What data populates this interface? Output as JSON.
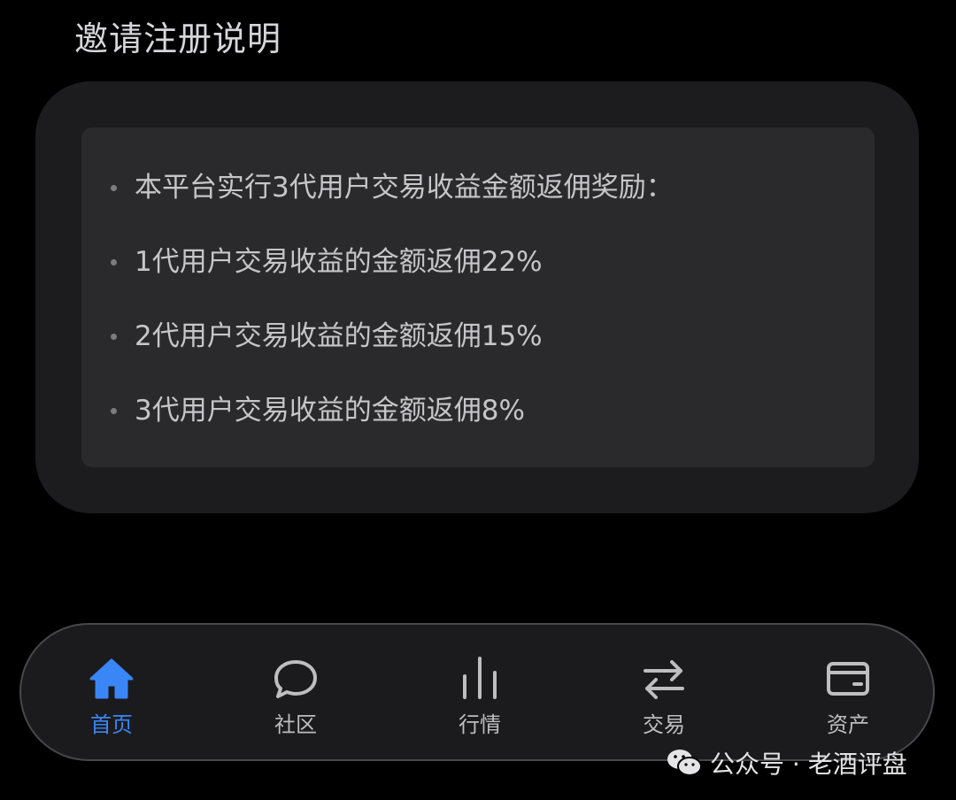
{
  "page": {
    "title": "邀请注册说明"
  },
  "rules": [
    "本平台实行3代用户交易收益金额返佣奖励：",
    "1代用户交易收益的金额返佣22%",
    "2代用户交易收益的金额返佣15%",
    "3代用户交易收益的金额返佣8%"
  ],
  "tabbar": {
    "items": [
      {
        "label": "首页",
        "icon": "home-icon",
        "active": true
      },
      {
        "label": "社区",
        "icon": "chat-bubble-icon",
        "active": false
      },
      {
        "label": "行情",
        "icon": "bar-chart-icon",
        "active": false
      },
      {
        "label": "交易",
        "icon": "swap-arrows-icon",
        "active": false
      },
      {
        "label": "资产",
        "icon": "wallet-card-icon",
        "active": false
      }
    ]
  },
  "watermark": {
    "text": "公众号 · 老酒评盘",
    "icon": "wechat-icon"
  },
  "colors": {
    "background": "#000000",
    "card_outer": "#1c1c1e",
    "card_inner": "#2a2a2d",
    "accent": "#3a86f7",
    "text_primary": "#c6c6ca"
  }
}
